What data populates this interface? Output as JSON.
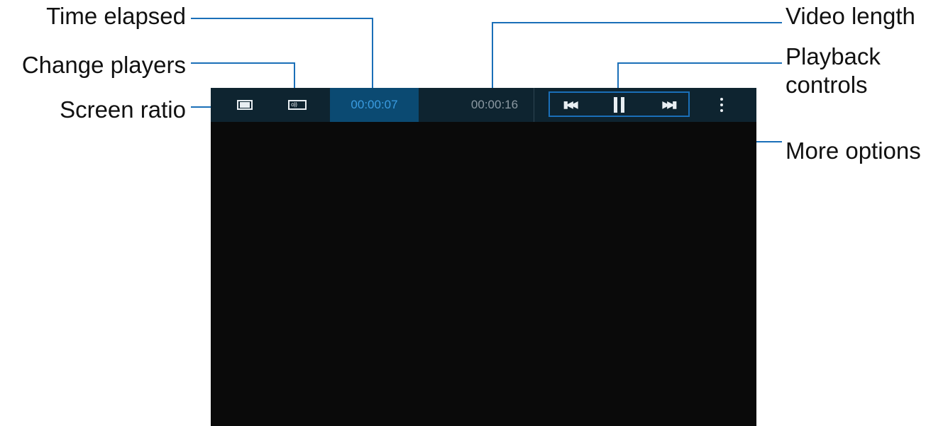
{
  "callouts": {
    "time_elapsed": "Time elapsed",
    "change_players": "Change players",
    "screen_ratio": "Screen ratio",
    "video_length": "Video length",
    "playback_controls_line1": "Playback",
    "playback_controls_line2": "controls",
    "more_options": "More options"
  },
  "player": {
    "elapsed": "00:00:07",
    "length": "00:00:16",
    "icons": {
      "screen_ratio": "screen-ratio-icon",
      "change_players": "change-players-icon",
      "previous": "previous-track-icon",
      "pause": "pause-icon",
      "next": "next-track-icon",
      "more": "more-options-icon"
    }
  },
  "colors": {
    "toolbar": "#0e2430",
    "elapsed_highlight": "#0b4a72",
    "accent": "#1a6fb8",
    "elapsed_text": "#3a9be0",
    "video_area": "#0a0a0a"
  }
}
